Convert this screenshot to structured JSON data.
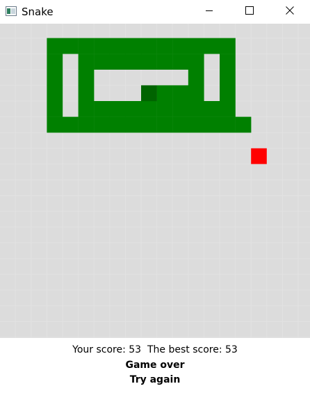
{
  "window": {
    "title": "Snake",
    "icon": "snake-app-icon",
    "controls": [
      "minimize-icon",
      "maximize-icon",
      "close-icon"
    ]
  },
  "board": {
    "background_color": "#dcdcdc",
    "grid_line_color": "#e2e2e2",
    "snake_color": "#008000",
    "snake_head_color": "#006400",
    "food_color": "#ff0000",
    "snake": [
      [
        6,
        15
      ],
      [
        6,
        14
      ],
      [
        6,
        13
      ],
      [
        6,
        12
      ],
      [
        6,
        11
      ],
      [
        6,
        10
      ],
      [
        6,
        9
      ],
      [
        6,
        8
      ],
      [
        6,
        7
      ],
      [
        6,
        6
      ],
      [
        6,
        5
      ],
      [
        6,
        4
      ],
      [
        6,
        3
      ],
      [
        5,
        3
      ],
      [
        4,
        3
      ],
      [
        3,
        3
      ],
      [
        2,
        3
      ],
      [
        1,
        3
      ],
      [
        1,
        4
      ],
      [
        1,
        5
      ],
      [
        1,
        6
      ],
      [
        1,
        7
      ],
      [
        1,
        8
      ],
      [
        1,
        9
      ],
      [
        1,
        10
      ],
      [
        1,
        11
      ],
      [
        1,
        12
      ],
      [
        1,
        13
      ],
      [
        1,
        14
      ],
      [
        2,
        14
      ],
      [
        3,
        14
      ],
      [
        4,
        14
      ],
      [
        5,
        14
      ],
      [
        5,
        13
      ],
      [
        5,
        12
      ],
      [
        5,
        11
      ],
      [
        5,
        10
      ],
      [
        5,
        9
      ],
      [
        5,
        8
      ],
      [
        5,
        7
      ],
      [
        5,
        6
      ],
      [
        5,
        5
      ],
      [
        4,
        5
      ],
      [
        3,
        5
      ],
      [
        2,
        5
      ],
      [
        2,
        6
      ],
      [
        2,
        7
      ],
      [
        2,
        8
      ],
      [
        2,
        9
      ],
      [
        2,
        10
      ],
      [
        2,
        11
      ],
      [
        2,
        12
      ],
      [
        3,
        12
      ],
      [
        4,
        12
      ],
      [
        4,
        11
      ],
      [
        4,
        10
      ],
      [
        4,
        9
      ]
    ],
    "food": [
      8,
      16
    ]
  },
  "footer": {
    "score_label": "Your score: 53",
    "best_label": "The best score: 53",
    "game_over": "Game over",
    "try_again": "Try again"
  }
}
